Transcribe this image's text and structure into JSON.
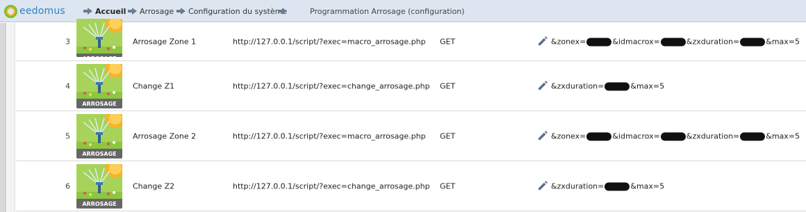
{
  "header": {
    "logo_text": "eedomus",
    "breadcrumb": [
      {
        "label": "Accueil"
      },
      {
        "label": "Arrosage"
      },
      {
        "label": "Configuration du système"
      }
    ],
    "page_title": "Programmation Arrosage (configuration)"
  },
  "thumbnail_label": "ARROSAGE",
  "rows": [
    {
      "number": "3",
      "name": "Arrosage Zone 1",
      "url": "http://127.0.0.1/script/?exec=macro_arrosage.php",
      "method": "GET",
      "params": [
        "&zonex=",
        "&idmacrox=",
        "&zxduration=",
        "&max=5"
      ]
    },
    {
      "number": "4",
      "name": "Change Z1",
      "url": "http://127.0.0.1/script/?exec=change_arrosage.php",
      "method": "GET",
      "params": [
        "&zxduration=",
        "&max=5"
      ]
    },
    {
      "number": "5",
      "name": "Arrosage Zone 2",
      "url": "http://127.0.0.1/script/?exec=macro_arrosage.php",
      "method": "GET",
      "params": [
        "&zonex=",
        "&idmacrox=",
        "&zxduration=",
        "&max=5"
      ]
    },
    {
      "number": "6",
      "name": "Change Z2",
      "url": "http://127.0.0.1/script/?exec=change_arrosage.php",
      "method": "GET",
      "params": [
        "&zxduration=",
        "&max=5"
      ]
    }
  ],
  "icons": {
    "edit": "pencil-icon",
    "breadcrumb_separator": "arrow-right-icon",
    "logo": "eedomus-logo-icon"
  },
  "colors": {
    "topbar": "#dde5f1",
    "link": "#2a84c5",
    "redaction": "#111111"
  }
}
